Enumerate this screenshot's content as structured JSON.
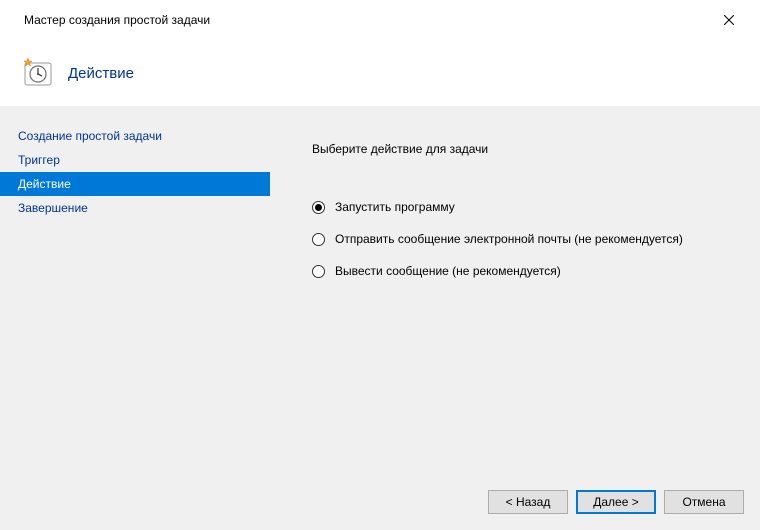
{
  "window": {
    "title": "Мастер создания простой задачи"
  },
  "header": {
    "title": "Действие"
  },
  "sidebar": {
    "items": [
      {
        "label": "Создание простой задачи",
        "selected": false
      },
      {
        "label": "Триггер",
        "selected": false
      },
      {
        "label": "Действие",
        "selected": true
      },
      {
        "label": "Завершение",
        "selected": false
      }
    ]
  },
  "main": {
    "instruction": "Выберите действие для задачи",
    "options": [
      {
        "label": "Запустить программу",
        "checked": true
      },
      {
        "label": "Отправить сообщение электронной почты (не рекомендуется)",
        "checked": false
      },
      {
        "label": "Вывести сообщение (не рекомендуется)",
        "checked": false
      }
    ]
  },
  "footer": {
    "back": "< Назад",
    "next": "Далее >",
    "cancel": "Отмена"
  }
}
